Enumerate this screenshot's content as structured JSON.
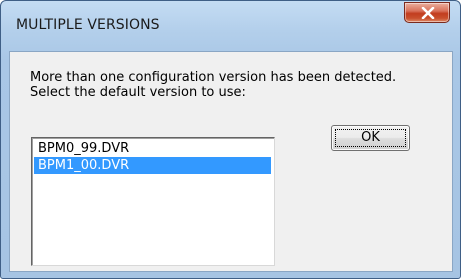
{
  "dialog": {
    "title": "MULTIPLE VERSIONS",
    "close_icon": "close-x-icon",
    "message_line1": "More than one configuration version has been detected.",
    "message_line2": "Select the default version to use:",
    "versions": [
      {
        "label": "BPM0_99.DVR",
        "selected": false
      },
      {
        "label": "BPM1_00.DVR",
        "selected": true
      }
    ],
    "ok_label": "OK"
  },
  "colors": {
    "selection": "#3399ff",
    "close_button": "#c23d1f",
    "client_background": "#f0f0f0"
  }
}
